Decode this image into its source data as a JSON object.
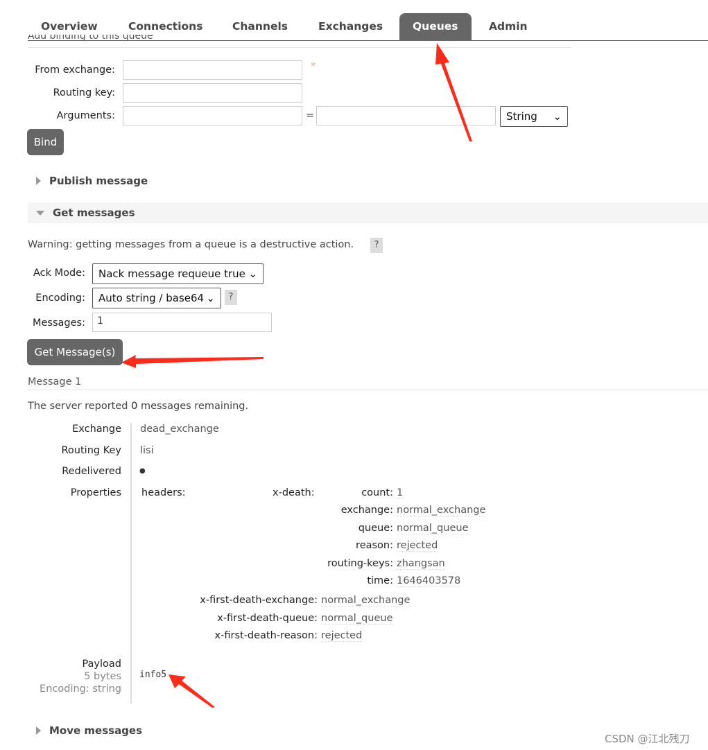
{
  "nav": {
    "tabs": [
      "Overview",
      "Connections",
      "Channels",
      "Exchanges",
      "Queues",
      "Admin"
    ],
    "active": "Queues"
  },
  "binding": {
    "heading": "Add binding to this queue",
    "from_exchange_label": "From exchange:",
    "from_exchange_value": "",
    "required_mark": "*",
    "routing_key_label": "Routing key:",
    "routing_key_value": "",
    "arguments_label": "Arguments:",
    "arg_key": "",
    "equals": "=",
    "arg_value": "",
    "type_select": "String",
    "bind_label": "Bind"
  },
  "publish": {
    "title": "Publish message"
  },
  "get": {
    "title": "Get messages",
    "warning": "Warning: getting messages from a queue is a destructive action.",
    "help": "?",
    "ack_label": "Ack Mode:",
    "ack_value": "Nack message requeue true",
    "encoding_label": "Encoding:",
    "encoding_value": "Auto string / base64",
    "messages_label": "Messages:",
    "messages_value": "1",
    "button": "Get Message(s)"
  },
  "result": {
    "heading": "Message 1",
    "remaining_prefix": "The server reported ",
    "remaining_count": "0",
    "remaining_suffix": " messages remaining.",
    "exchange_label": "Exchange",
    "exchange": "dead_exchange",
    "routing_key_label": "Routing Key",
    "routing_key": "lisi",
    "redelivered_label": "Redelivered",
    "redelivered": "●",
    "properties_label": "Properties",
    "headers_label": "headers:",
    "xdeath_label": "x-death:",
    "xdeath": [
      {
        "k": "count:",
        "v": "1"
      },
      {
        "k": "exchange:",
        "v": "normal_exchange"
      },
      {
        "k": "queue:",
        "v": "normal_queue"
      },
      {
        "k": "reason:",
        "v": "rejected"
      },
      {
        "k": "routing-keys:",
        "v": "zhangsan"
      },
      {
        "k": "time:",
        "v": "1646403578"
      }
    ],
    "first_death": [
      {
        "k": "x-first-death-exchange:",
        "v": "normal_exchange"
      },
      {
        "k": "x-first-death-queue:",
        "v": "normal_queue"
      },
      {
        "k": "x-first-death-reason:",
        "v": "rejected"
      }
    ],
    "payload_label": "Payload",
    "payload_size": "5 bytes",
    "payload_encoding": "Encoding: string",
    "payload": "info5"
  },
  "move": {
    "title": "Move messages"
  },
  "watermark": "CSDN @江北残刀",
  "colors": {
    "tab_active": "#666666",
    "annotation_arrow": "#ff2a1a"
  }
}
